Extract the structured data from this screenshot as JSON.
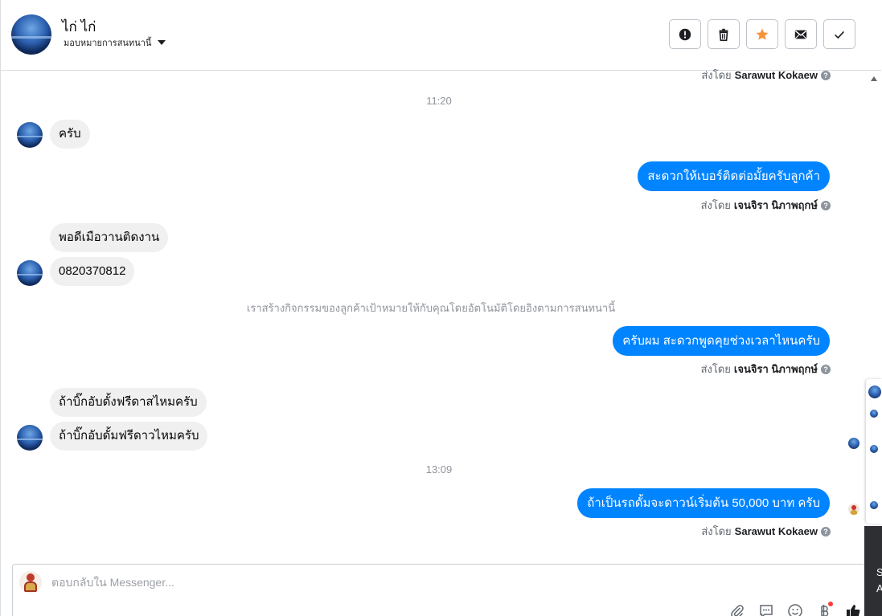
{
  "header": {
    "contact_name": "ไก่ ไก่",
    "assign_label": "มอบหมายการสนทนานี้",
    "actions": [
      {
        "name": "mark-spam-button",
        "icon": "exclamation-circle-icon"
      },
      {
        "name": "delete-button",
        "icon": "trash-icon"
      },
      {
        "name": "star-button",
        "icon": "star-icon",
        "color": "#f7923b"
      },
      {
        "name": "mark-unread-button",
        "icon": "envelope-icon"
      },
      {
        "name": "mark-done-button",
        "icon": "checkmark-icon"
      }
    ]
  },
  "conversation": {
    "top_sent_by_prefix": "ส่งโดย",
    "top_sent_by_name": "Sarawut Kokaew",
    "time_1": "11:20",
    "msg_in_1": "ครับ",
    "msg_out_1": "สะดวกให้เบอร์ติดต่อมั้ยครับลูกค้า",
    "sent_by_1_prefix": "ส่งโดย",
    "sent_by_1_name": "เจนจิรา นิภาพฤกษ์",
    "msg_in_2": "พอดีเมือวานติดงาน",
    "msg_in_3": "0820370812",
    "system_note": "เราสร้างกิจกรรมของลูกค้าเป้าหมายให้กับคุณโดยอัตโนมัติโดยอิงตามการสนทนานี้",
    "msg_out_2": "ครับผม สะดวกพูดคุยช่วงเวลาไหนครับ",
    "sent_by_2_prefix": "ส่งโดย",
    "sent_by_2_name": "เจนจิรา นิภาพฤกษ์",
    "msg_in_4": "ถ้าบิ๊กอับดั้งฟรีดาสไหมครับ",
    "msg_in_5": "ถ้าบิ๊กอับดั้มฟรีดาวไหมครับ",
    "time_2": "13:09",
    "msg_out_3": "ถ้าเป็นรถดั้มจะดาวน์เริ่มต้น 50,000 บาท ครับ",
    "sent_by_3_prefix": "ส่งโดย",
    "sent_by_3_name": "Sarawut Kokaew",
    "help_glyph": "?"
  },
  "composer": {
    "placeholder": "ตอบกลับใน Messenger...",
    "tools": [
      "paperclip-icon",
      "saved-reply-icon",
      "emoji-icon",
      "baht-icon",
      "like-icon"
    ]
  },
  "side_overlay": {
    "fragment_1": "S",
    "fragment_2": "A"
  },
  "colors": {
    "outgoing_bubble": "#0084ff",
    "incoming_bubble": "#f0f0f0",
    "star": "#f7923b"
  }
}
